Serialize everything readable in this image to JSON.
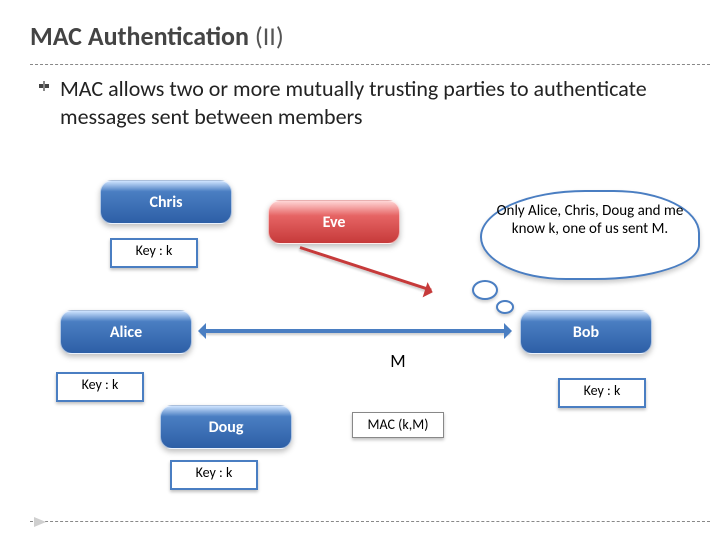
{
  "title_main": "MAC Authentication ",
  "title_suffix": "(II)",
  "body_text": "MAC allows two or more mutually trusting parties to authenticate messages sent between members",
  "nodes": {
    "chris": "Chris",
    "eve": "Eve",
    "alice": "Alice",
    "bob": "Bob",
    "doug": "Doug"
  },
  "key_label": "Key : k",
  "msg_label": "M",
  "mac_label": "MAC (k,M)",
  "thought_text": "Only Alice, Chris, Doug and me know k, one of us sent M."
}
